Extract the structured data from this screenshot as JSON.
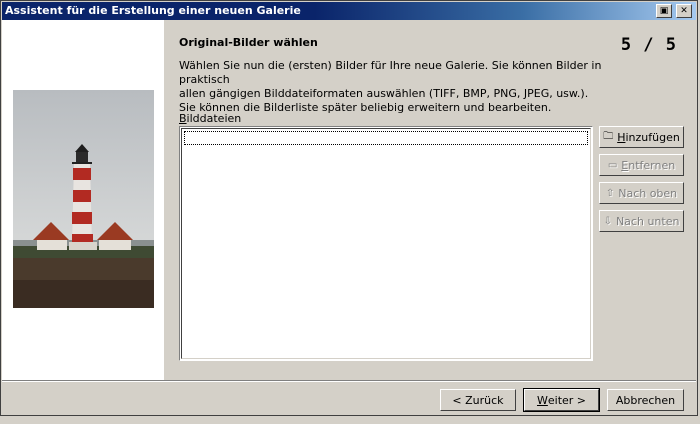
{
  "window": {
    "title": "Assistent für die Erstellung einer neuen Galerie",
    "restore_glyph": "▣",
    "close_glyph": "✕"
  },
  "step": {
    "heading": "Original-Bilder wählen",
    "counter": "5 / 5"
  },
  "description": "Wählen Sie nun die (ersten) Bilder für Ihre neue Galerie. Sie können Bilder in praktisch\nallen gängigen Bilddateiformaten auswählen (TIFF, BMP, PNG, JPEG, usw.).\nSie können die Bilderliste später beliebig erweitern und bearbeiten.",
  "list": {
    "label_first": "B",
    "label_rest": "ilddateien",
    "items": []
  },
  "side_buttons": {
    "add": {
      "label_first": "H",
      "label_rest": "inzufügen",
      "icon": "folder-add-icon"
    },
    "remove": {
      "label_first": "E",
      "label_rest": "ntfernen",
      "icon": "remove-icon"
    },
    "up": {
      "label": "Nach oben",
      "icon": "arrow-up-icon"
    },
    "down": {
      "label": "Nach unten",
      "icon": "arrow-down-icon"
    }
  },
  "footer": {
    "back": "< Zurück",
    "next_first": "W",
    "next_rest": "eiter >",
    "cancel": "Abbrechen"
  },
  "colors": {
    "titlebar": "#0a246a",
    "face": "#d4d0c8",
    "panel": "#ffffff"
  }
}
